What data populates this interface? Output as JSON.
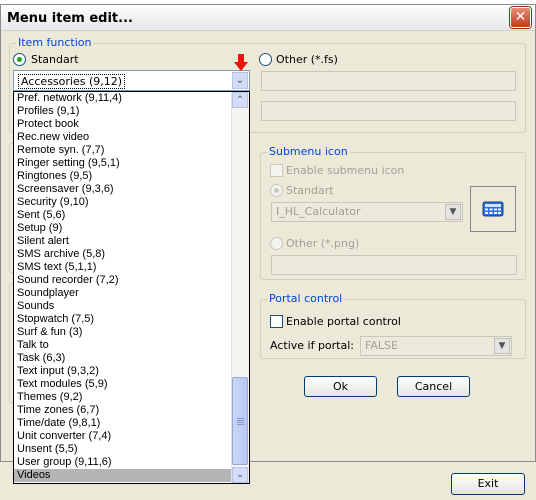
{
  "dialog": {
    "title": "Menu item edit...",
    "close_glyph": "✕"
  },
  "item_function": {
    "legend": "Item function",
    "standart_label": "Standart",
    "other_label": "Other  (*.fs)",
    "selected_value": "Accessories (9,12)",
    "list": [
      "Pref. network (9,11,4)",
      "Profiles (9,1)",
      "Protect book",
      "Rec.new video",
      "Remote syn. (7,7)",
      "Ringer setting (9,5,1)",
      "Ringtones (9,5)",
      "Screensaver (9,3,6)",
      "Security (9,10)",
      "Sent (5,6)",
      "Setup (9)",
      "Silent alert",
      "SMS archive (5,8)",
      "SMS text (5,1,1)",
      "Sound recorder (7,2)",
      "Soundplayer",
      "Sounds",
      "Stopwatch (7,5)",
      "Surf & fun (3)",
      "Talk to",
      "Task (6,3)",
      "Text input (9,3,2)",
      "Text modules (5,9)",
      "Themes (9,2)",
      "Time zones (6,7)",
      "Time/date (9,8,1)",
      "Unit converter (7,4)",
      "Unsent (5,5)",
      "User group (9,11,6)",
      "Videos"
    ],
    "selected_index": 29
  },
  "submenu_icon": {
    "legend": "Submenu icon",
    "enable_label": "Enable submenu icon",
    "standart_label": "Standart",
    "icon_value": "I_HL_Calculator",
    "other_label": "Other  (*.png)"
  },
  "portal_control": {
    "legend": "Portal control",
    "enable_label": "Enable portal control",
    "active_label": "Active if portal:",
    "active_value": "FALSE"
  },
  "buttons": {
    "ok": "Ok",
    "cancel": "Cancel",
    "exit": "Exit"
  },
  "colors": {
    "legend": "#0046d5",
    "dialog_bg": "#ece9d8",
    "selection": "#b5b5b5",
    "close": "#c6381b",
    "pointer": "#e8150c"
  },
  "icons": [
    "close-icon",
    "chevron-down-icon",
    "calculator-icon",
    "red-arrow-down-icon",
    "chevron-up-icon"
  ]
}
